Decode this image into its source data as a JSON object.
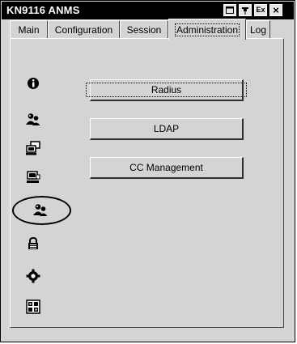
{
  "window": {
    "title": "KN9116 ANMS",
    "controls": [
      {
        "name": "restore",
        "label": ""
      },
      {
        "name": "pin",
        "label": ""
      },
      {
        "name": "exit",
        "label": "Ex"
      },
      {
        "name": "close",
        "label": "×"
      }
    ]
  },
  "tabs": [
    {
      "label": "Main",
      "active": false
    },
    {
      "label": "Configuration",
      "active": false
    },
    {
      "label": "Session",
      "active": false
    },
    {
      "label": "Administration",
      "active": true
    },
    {
      "label": "Log",
      "active": false
    }
  ],
  "sidebar_icons": [
    "info-icon",
    "user-icon",
    "computer-network-icon",
    "computer-icon",
    "user-management-icon",
    "lock-icon",
    "gear-icon",
    "registry-icon"
  ],
  "buttons": [
    {
      "label": "Radius",
      "focused": true
    },
    {
      "label": "LDAP",
      "focused": false
    },
    {
      "label": "CC Management",
      "focused": false
    }
  ]
}
